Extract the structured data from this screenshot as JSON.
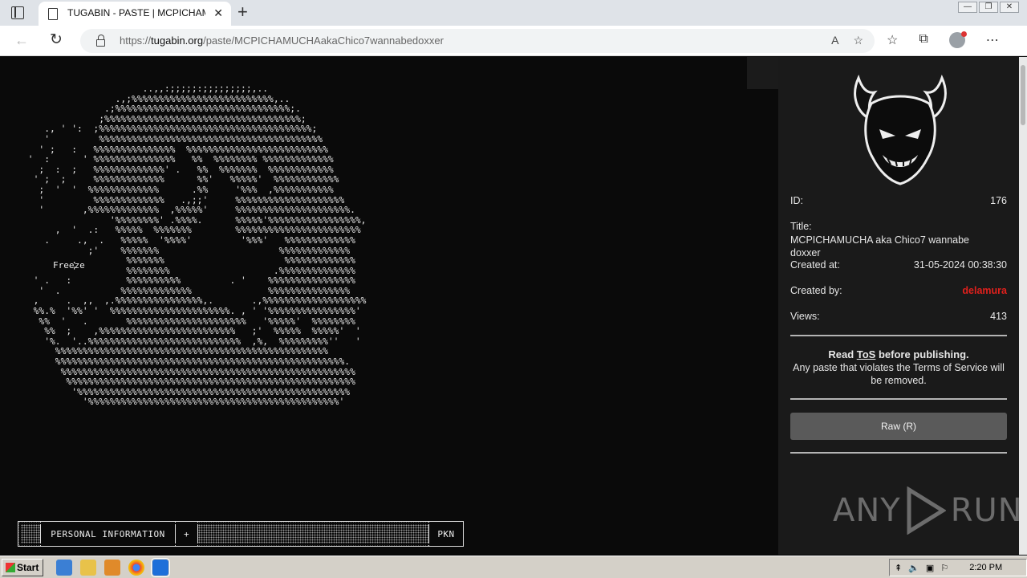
{
  "browser": {
    "tab_title": "TUGABIN - PASTE | MCPICHAMU",
    "tab_close": "✕",
    "new_tab": "+",
    "url_prefix": "https://",
    "url_host": "tugabin.org",
    "url_path": "/paste/MCPICHAMUCHAakaChico7wannabedoxxer",
    "read_aloud": "A",
    "add_favorite": "☆",
    "favorites": "☆",
    "collections": "⧉",
    "more": "⋯",
    "min": "—",
    "restore": "❐",
    "close": "✕"
  },
  "art": {
    "freeze_label": "Freeze",
    "menu": {
      "left_fill": "",
      "personal_info": "PERSONAL INFORMATION",
      "plus": "+",
      "middle_fill": "",
      "pkn": "PKN"
    }
  },
  "paste": {
    "id_label": "ID:",
    "id_value": "176",
    "title_label": "Title:",
    "title_value": "MCPICHAMUCHA aka Chico7 wannabe doxxer",
    "created_at_label": "Created at:",
    "created_at_value": "31-05-2024 00:38:30",
    "created_by_label": "Created by:",
    "created_by_value": "delamura",
    "views_label": "Views:",
    "views_value": "413",
    "tos_read": "Read ",
    "tos_link": "ToS",
    "tos_after": " before publishing.",
    "tos_text": "Any paste that violates the Terms of Service will be removed.",
    "raw_button": "Raw (R)"
  },
  "watermark": {
    "left": "ANY",
    "right": "RUN"
  },
  "taskbar": {
    "start": "Start",
    "clock": "2:20 PM"
  }
}
